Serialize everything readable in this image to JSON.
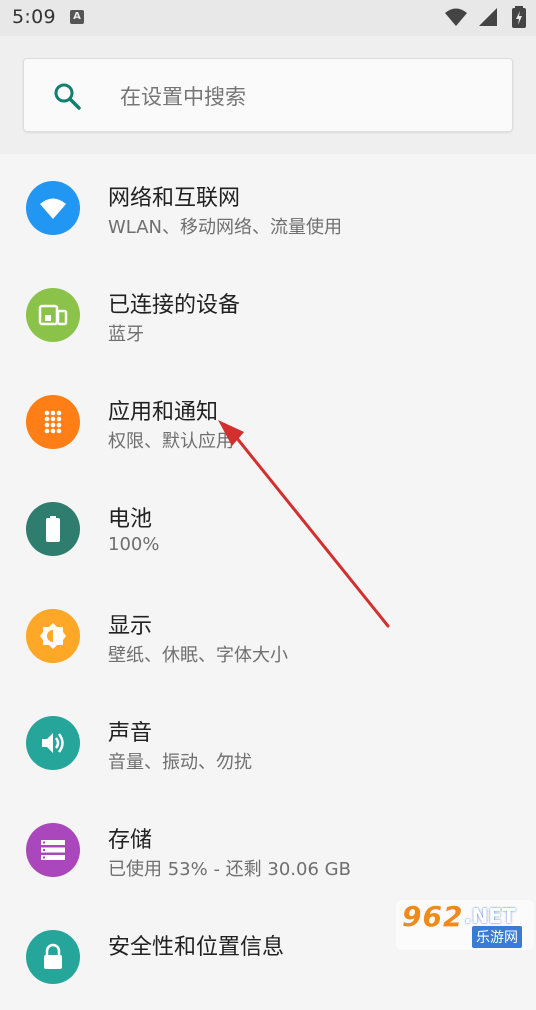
{
  "status_bar": {
    "time": "5:09",
    "notification_letter": "A",
    "icons": [
      "wifi-icon",
      "signal-icon",
      "battery-icon"
    ]
  },
  "search": {
    "placeholder": "在设置中搜索"
  },
  "settings": {
    "items": [
      {
        "title": "网络和互联网",
        "summary": "WLAN、移动网络、流量使用",
        "icon": "wifi-icon",
        "color": "#2196F3"
      },
      {
        "title": "已连接的设备",
        "summary": "蓝牙",
        "icon": "devices-icon",
        "color": "#8BC34A"
      },
      {
        "title": "应用和通知",
        "summary": "权限、默认应用",
        "icon": "apps-icon",
        "color": "#FF7F16"
      },
      {
        "title": "电池",
        "summary": "100%",
        "icon": "battery-icon",
        "color": "#2E7D6E"
      },
      {
        "title": "显示",
        "summary": "壁纸、休眠、字体大小",
        "icon": "brightness-icon",
        "color": "#FFA726"
      },
      {
        "title": "声音",
        "summary": "音量、振动、勿扰",
        "icon": "volume-icon",
        "color": "#26A69A"
      },
      {
        "title": "存储",
        "summary": "已使用 53% - 还剩 30.06 GB",
        "icon": "storage-icon",
        "color": "#AB47BC"
      },
      {
        "title": "安全性和位置信息",
        "summary": "",
        "icon": "lock-icon",
        "color": "#26A69A"
      }
    ]
  },
  "annotation": {
    "arrow_color": "#D32F2F"
  },
  "watermark": {
    "logo": "962",
    "logo_suffix": ".NET",
    "sub": "乐游网"
  }
}
